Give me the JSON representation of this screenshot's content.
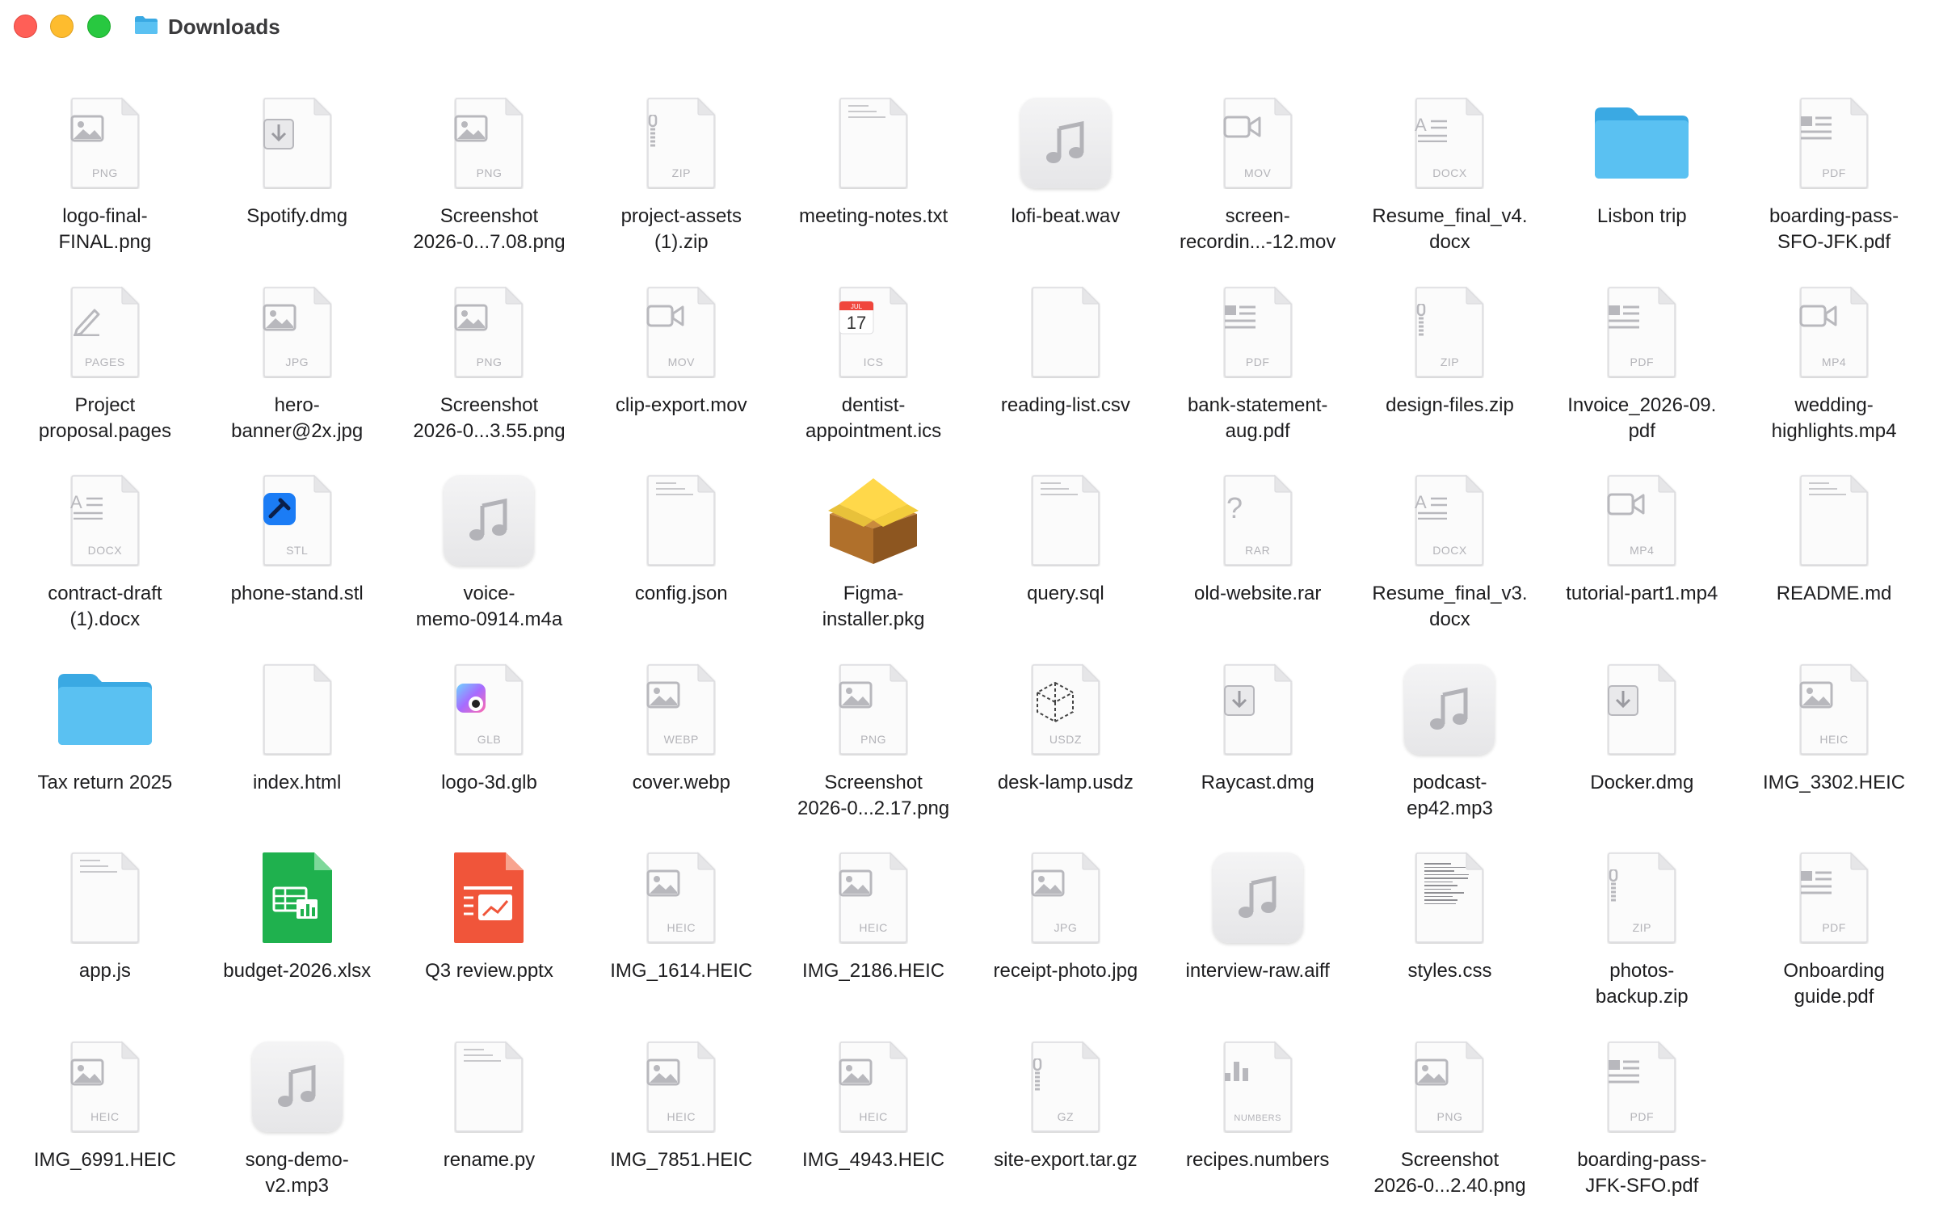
{
  "window": {
    "title": "Downloads"
  },
  "files": [
    {
      "name": "logo-final-\nFINAL.png",
      "kind": "image",
      "ext": "PNG"
    },
    {
      "name": "Spotify.dmg",
      "kind": "dmg",
      "ext": ""
    },
    {
      "name": "Screenshot\n2026-0...7.08.png",
      "kind": "image",
      "ext": "PNG"
    },
    {
      "name": "project-assets\n(1).zip",
      "kind": "zip",
      "ext": "ZIP"
    },
    {
      "name": "meeting-notes.txt",
      "kind": "text",
      "ext": ""
    },
    {
      "name": "lofi-beat.wav",
      "kind": "audio",
      "ext": ""
    },
    {
      "name": "screen-\nrecordin...-12.mov",
      "kind": "video",
      "ext": "MOV"
    },
    {
      "name": "Resume_final_v4.\ndocx",
      "kind": "docx",
      "ext": "DOCX"
    },
    {
      "name": "Lisbon trip",
      "kind": "folder",
      "ext": ""
    },
    {
      "name": "boarding-pass-\nSFO-JFK.pdf",
      "kind": "pdf",
      "ext": "PDF"
    },
    {
      "name": "Project\nproposal.pages",
      "kind": "pages",
      "ext": "PAGES"
    },
    {
      "name": "hero-\nbanner@2x.jpg",
      "kind": "image",
      "ext": "JPG"
    },
    {
      "name": "Screenshot\n2026-0...3.55.png",
      "kind": "image",
      "ext": "PNG"
    },
    {
      "name": "clip-export.mov",
      "kind": "video",
      "ext": "MOV"
    },
    {
      "name": "dentist-\nappointment.ics",
      "kind": "ics",
      "ext": "ICS"
    },
    {
      "name": "reading-list.csv",
      "kind": "blank",
      "ext": ""
    },
    {
      "name": "bank-statement-\naug.pdf",
      "kind": "pdf",
      "ext": "PDF"
    },
    {
      "name": "design-files.zip",
      "kind": "zip",
      "ext": "ZIP"
    },
    {
      "name": "Invoice_2026-09.\npdf",
      "kind": "pdf",
      "ext": "PDF"
    },
    {
      "name": "wedding-\nhighlights.mp4",
      "kind": "video",
      "ext": "MP4"
    },
    {
      "name": "contract-draft\n(1).docx",
      "kind": "docx",
      "ext": "DOCX"
    },
    {
      "name": "phone-stand.stl",
      "kind": "stl",
      "ext": "STL"
    },
    {
      "name": "voice-\nmemo-0914.m4a",
      "kind": "audio",
      "ext": ""
    },
    {
      "name": "config.json",
      "kind": "text",
      "ext": ""
    },
    {
      "name": "Figma-\ninstaller.pkg",
      "kind": "pkg",
      "ext": ""
    },
    {
      "name": "query.sql",
      "kind": "text",
      "ext": ""
    },
    {
      "name": "old-website.rar",
      "kind": "rar",
      "ext": "RAR"
    },
    {
      "name": "Resume_final_v3.\ndocx",
      "kind": "docx",
      "ext": "DOCX"
    },
    {
      "name": "tutorial-part1.mp4",
      "kind": "video",
      "ext": "MP4"
    },
    {
      "name": "README.md",
      "kind": "text",
      "ext": ""
    },
    {
      "name": "Tax return 2025",
      "kind": "folder",
      "ext": ""
    },
    {
      "name": "index.html",
      "kind": "blank",
      "ext": ""
    },
    {
      "name": "logo-3d.glb",
      "kind": "glb",
      "ext": "GLB"
    },
    {
      "name": "cover.webp",
      "kind": "image",
      "ext": "WEBP"
    },
    {
      "name": "Screenshot\n2026-0...2.17.png",
      "kind": "image",
      "ext": "PNG"
    },
    {
      "name": "desk-lamp.usdz",
      "kind": "usdz",
      "ext": "USDZ"
    },
    {
      "name": "Raycast.dmg",
      "kind": "dmg",
      "ext": ""
    },
    {
      "name": "podcast-\nep42.mp3",
      "kind": "audio",
      "ext": ""
    },
    {
      "name": "Docker.dmg",
      "kind": "dmg",
      "ext": ""
    },
    {
      "name": "IMG_3302.HEIC",
      "kind": "image",
      "ext": "HEIC"
    },
    {
      "name": "app.js",
      "kind": "text",
      "ext": ""
    },
    {
      "name": "budget-2026.xlsx",
      "kind": "xlsx",
      "ext": ""
    },
    {
      "name": "Q3 review.pptx",
      "kind": "pptx",
      "ext": ""
    },
    {
      "name": "IMG_1614.HEIC",
      "kind": "image",
      "ext": "HEIC"
    },
    {
      "name": "IMG_2186.HEIC",
      "kind": "image",
      "ext": "HEIC"
    },
    {
      "name": "receipt-photo.jpg",
      "kind": "image",
      "ext": "JPG"
    },
    {
      "name": "interview-raw.aiff",
      "kind": "audio",
      "ext": ""
    },
    {
      "name": "styles.css",
      "kind": "code",
      "ext": ""
    },
    {
      "name": "photos-\nbackup.zip",
      "kind": "zip",
      "ext": "ZIP"
    },
    {
      "name": "Onboarding\nguide.pdf",
      "kind": "pdf",
      "ext": "PDF"
    },
    {
      "name": "IMG_6991.HEIC",
      "kind": "image",
      "ext": "HEIC"
    },
    {
      "name": "song-demo-\nv2.mp3",
      "kind": "audio",
      "ext": ""
    },
    {
      "name": "rename.py",
      "kind": "text",
      "ext": ""
    },
    {
      "name": "IMG_7851.HEIC",
      "kind": "image",
      "ext": "HEIC"
    },
    {
      "name": "IMG_4943.HEIC",
      "kind": "image",
      "ext": "HEIC"
    },
    {
      "name": "site-export.tar.gz",
      "kind": "zip",
      "ext": "GZ"
    },
    {
      "name": "recipes.numbers",
      "kind": "numbers",
      "ext": "NUMBERS"
    },
    {
      "name": "Screenshot\n2026-0...2.40.png",
      "kind": "image",
      "ext": "PNG"
    },
    {
      "name": "boarding-pass-\nJFK-SFO.pdf",
      "kind": "pdf",
      "ext": "PDF"
    }
  ],
  "ics_badge": {
    "month": "JUL",
    "day": "17"
  },
  "colors": {
    "folder": "#5ac1f2",
    "folder_dark": "#3aa9e3",
    "glyph": "#b8b8bd"
  }
}
